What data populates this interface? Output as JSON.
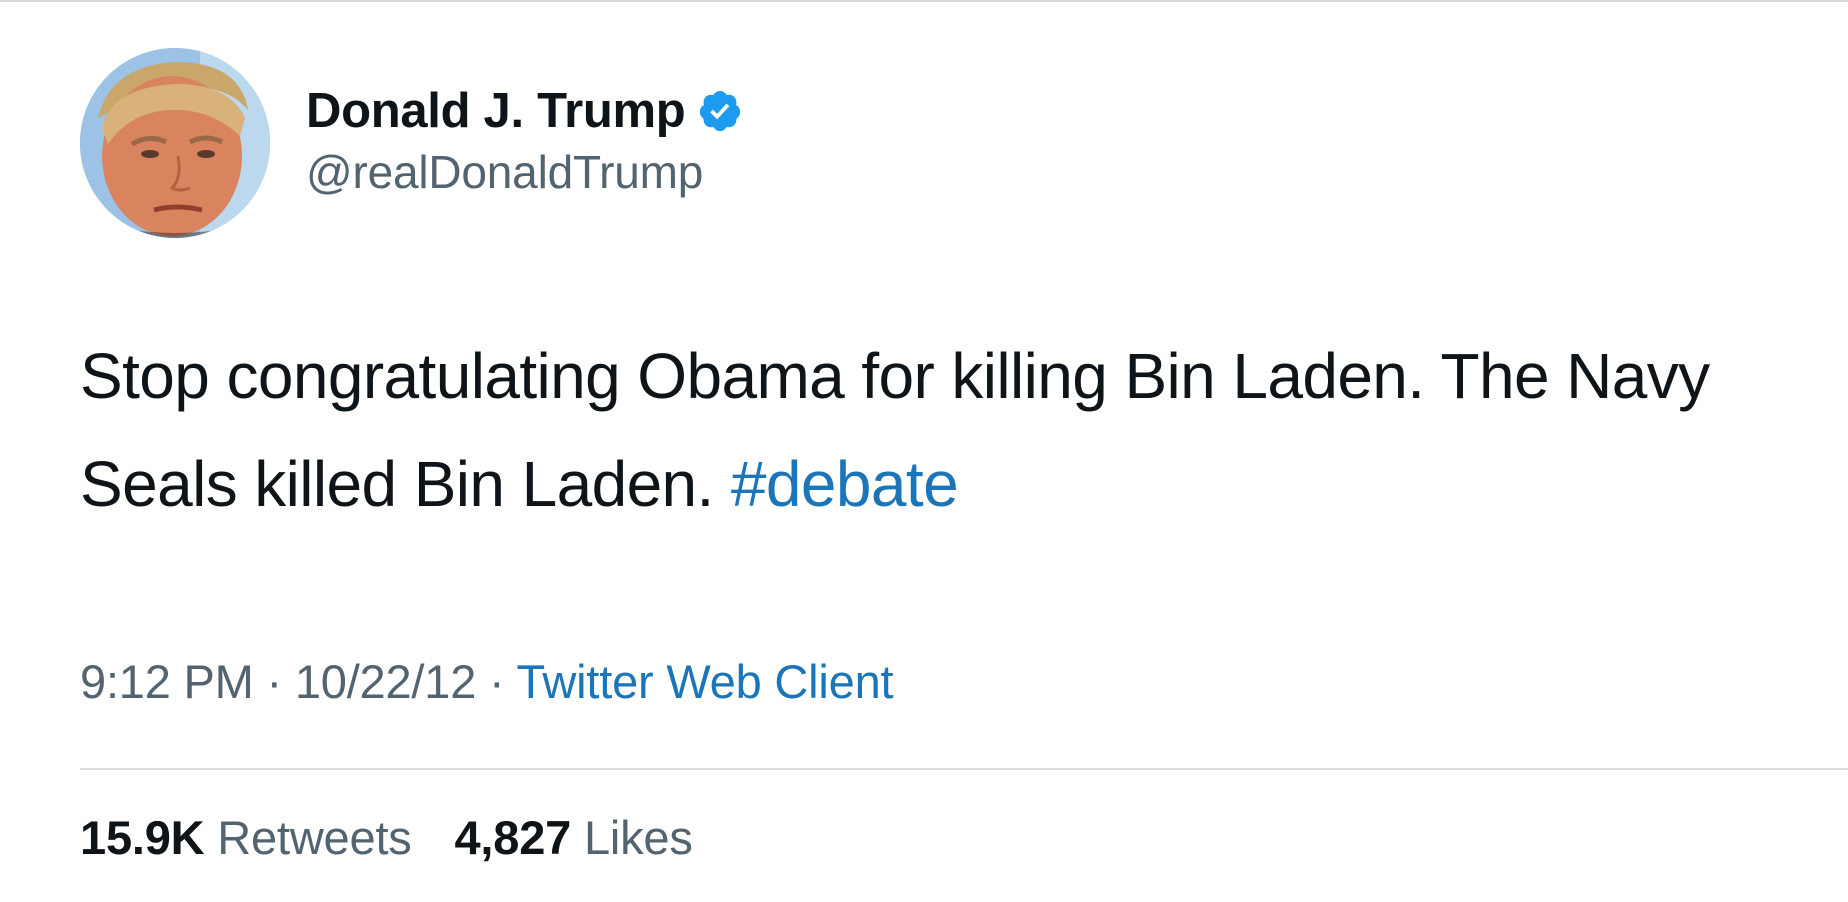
{
  "tweet": {
    "author": {
      "display_name": "Donald J. Trump",
      "handle": "@realDonaldTrump",
      "verified": true,
      "verified_icon": "verified-badge-icon",
      "verified_color": "#1d9bf0"
    },
    "text_line_1": "Stop congratulating Obama for killing Bin Laden. The Navy",
    "text_line_2": "Seals killed Bin Laden.",
    "hashtag": "#debate",
    "time": "9:12 PM",
    "separator": "·",
    "date": "10/22/12",
    "source": "Twitter Web Client",
    "retweets_count": "15.9K",
    "retweets_label": "Retweets",
    "likes_count": "4,827",
    "likes_label": "Likes"
  },
  "colors": {
    "text_primary": "#0f1419",
    "text_secondary": "#536471",
    "link": "#1b75b8",
    "divider": "#dcdcdc"
  }
}
